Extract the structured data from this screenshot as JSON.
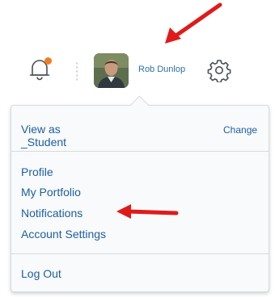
{
  "header": {
    "user_name": "Rob Dunlop"
  },
  "menu": {
    "view_as": "View as _Student",
    "change": "Change",
    "links": [
      "Profile",
      "My Portfolio",
      "Notifications",
      "Account Settings"
    ],
    "logout": "Log Out"
  },
  "colors": {
    "link": "#1d5fa0",
    "notification_dot": "#f47c20",
    "annotation_arrow": "#e01a1a"
  },
  "icons": [
    "bell-icon",
    "gear-icon"
  ]
}
